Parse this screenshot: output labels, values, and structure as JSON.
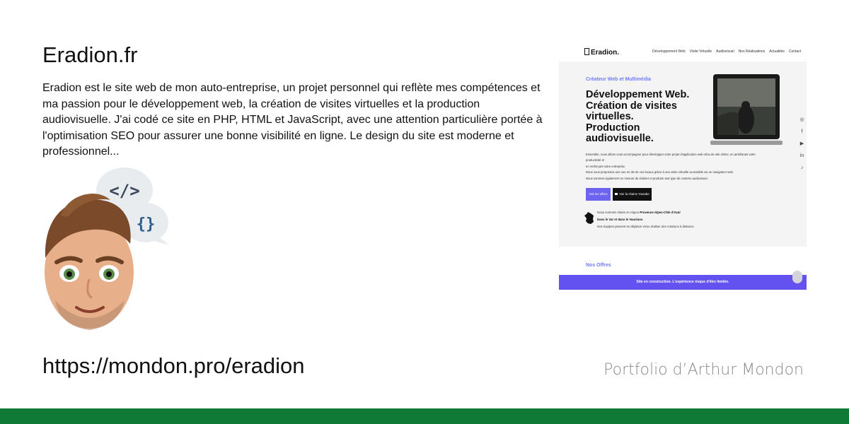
{
  "card": {
    "title": "Eradion.fr",
    "description": "Eradion est le site web de mon auto-entreprise, un projet personnel qui reflète mes compétences et ma passion pour le développement web, la création de visites virtuelles et la production audiovisuelle. J'ai codé ce site en PHP, HTML et JavaScript, avec une attention particulière portée à l'optimisation SEO pour assurer une bonne visibilité en ligne.    Le design du site est moderne et professionnel...",
    "url": "https://mondon.pro/eradion",
    "brand": "Portfolio d’Arthur Mondon",
    "accent_color": "#0f7a36"
  },
  "preview": {
    "logo": "Eradion.",
    "menu": [
      "Développement Web",
      "Visite Virtuelle",
      "Audiovisuel",
      "Nos Réalisations",
      "Actualités",
      "Contact"
    ],
    "kicker": "Créateur Web et Multimédia",
    "headline": "Développement Web.\nCréation de visites virtuelles.\nProduction audiovisuelle.",
    "body_lines": [
      "Ensemble, nous allons vous accompagner pour développer votre projet d'application web et/ou de site vitrine, en améliorant votre productivité et",
      "en renforçant votre entreprise.",
      "Nous vous proposons une vue en 3D de vos locaux grâce à une visite virtuelle accessible via un navigateur web.",
      "Nous sommes également en mesure de réaliser et produire tout type de contenu audiovisuel."
    ],
    "button_offers": "Voir les offres",
    "button_youtube": "Voir la chaine Youtube",
    "location_intro": "Nous sommes situés en région",
    "location_region": "Provence-Alpes-Côte d'Azur",
    "location_dept": "Dans le Var et dans le Vaucluse.",
    "location_note": "Nos équipes peuvent se déplacer et/ou réaliser des missions à distance.",
    "social_icons": [
      "instagram-icon",
      "facebook-icon",
      "youtube-icon",
      "linkedin-icon",
      "tiktok-icon"
    ],
    "offers_title": "Nos Offres",
    "banner": "Site en construction. L'expérience risque d'être limitée.",
    "accent_color": "#6351f0"
  }
}
